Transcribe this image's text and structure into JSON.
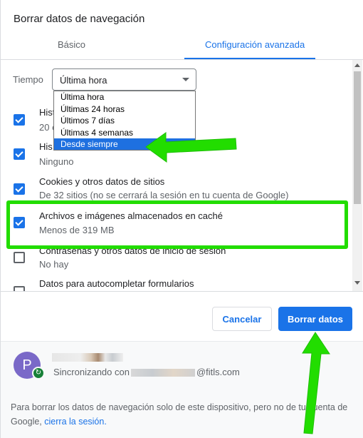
{
  "dialog": {
    "title": "Borrar datos de navegación",
    "tabs": {
      "basic": "Básico",
      "advanced": "Configuración avanzada"
    }
  },
  "time_range": {
    "label": "Tiempo",
    "selected": "Última hora",
    "options": [
      "Última hora",
      "Últimas 24 horas",
      "Últimos 7 días",
      "Últimas 4 semanas",
      "Desde siempre"
    ],
    "highlighted_option": "Desde siempre"
  },
  "items": [
    {
      "title": "Historial de navegación",
      "visible_title": "Hist",
      "subtitle": "20 e",
      "checked": true
    },
    {
      "title": "Historial de descargas",
      "visible_title": "His",
      "subtitle": "Ninguno",
      "checked": true
    },
    {
      "title": "Cookies y otros datos de sitios",
      "subtitle": "De 32 sitios (no se cerrará la sesión en tu cuenta de Google)",
      "checked": true
    },
    {
      "title": "Archivos e imágenes almacenados en caché",
      "subtitle": "Menos de 319 MB",
      "checked": true
    },
    {
      "title": "Contraseñas y otros datos de inicio de sesión",
      "subtitle": "No hay",
      "checked": false
    },
    {
      "title": "Datos para autocompletar formularios",
      "subtitle": "",
      "checked": false
    }
  ],
  "buttons": {
    "cancel": "Cancelar",
    "clear": "Borrar datos"
  },
  "account": {
    "avatar_letter": "P",
    "sync_prefix": "Sincronizando con",
    "email_suffix": "@fitls.com",
    "note": "Para borrar los datos de navegación solo de este dispositivo, pero no de tu cuenta de Google,",
    "signout_link": "cierra la sesión."
  },
  "colors": {
    "accent": "#1a73e8",
    "annotation": "#22dd00"
  }
}
